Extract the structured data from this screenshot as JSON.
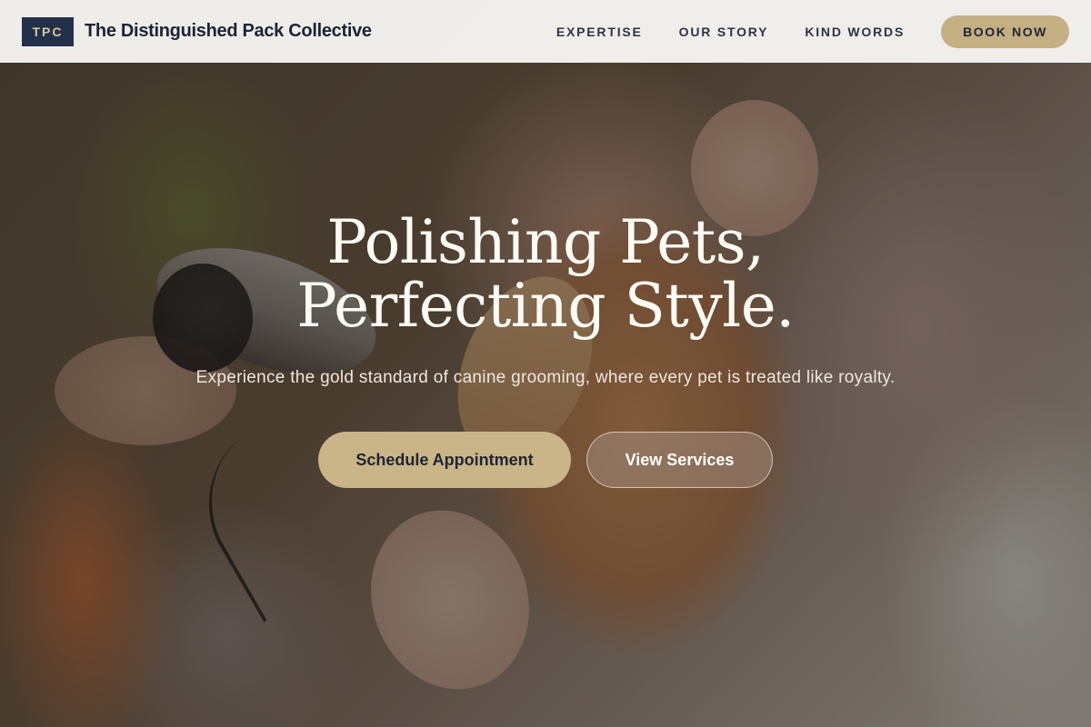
{
  "header": {
    "logo_badge": "TPC",
    "brand_name": "The Distinguished Pack Collective",
    "nav": [
      "EXPERTISE",
      "OUR STORY",
      "KIND WORDS"
    ],
    "cta": "BOOK NOW"
  },
  "hero": {
    "headline_line1": "Polishing Pets,",
    "headline_line2": "Perfecting Style.",
    "subtitle": "Experience the gold standard of canine grooming, where every pet is treated like royalty.",
    "primary_cta": "Schedule Appointment",
    "secondary_cta": "View Services"
  },
  "colors": {
    "navy": "#23304a",
    "gold": "#c5b083",
    "header_bg": "#f7f5f2"
  }
}
